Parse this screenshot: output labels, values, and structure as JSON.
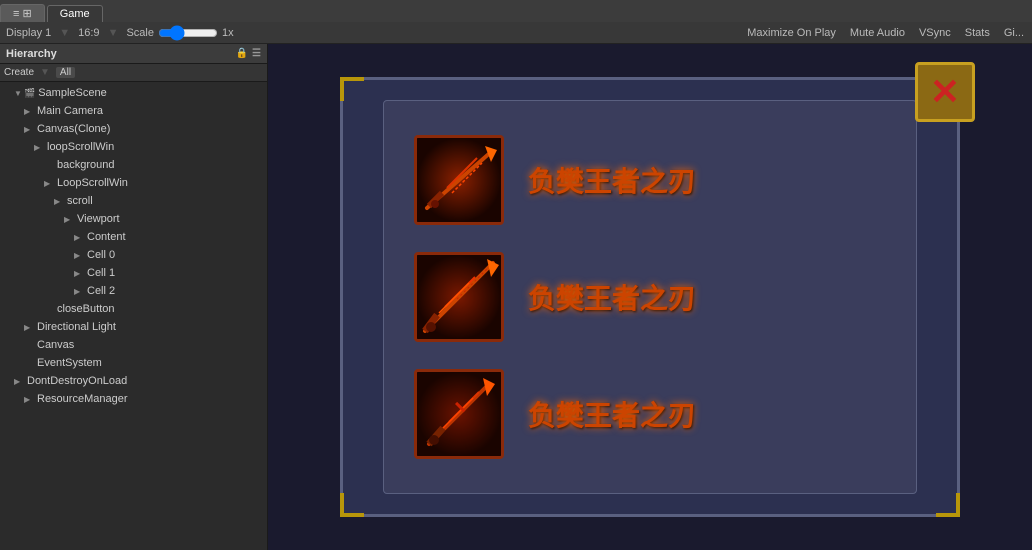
{
  "tabs": [
    {
      "label": "≡ ⊞",
      "active": false
    },
    {
      "label": "Game",
      "active": true
    }
  ],
  "toolbar": {
    "display_label": "Display 1",
    "aspect_label": "16:9",
    "scale_label": "Scale",
    "scale_value": "1x",
    "maximize_label": "Maximize On Play",
    "mute_label": "Mute Audio",
    "vsync_label": "VSync",
    "stats_label": "Stats",
    "gizmos_label": "Gi..."
  },
  "hierarchy": {
    "title": "Hierarchy",
    "create_label": "Create",
    "all_label": "All",
    "scene_name": "SampleScene",
    "items": [
      {
        "label": "Main Camera",
        "indent": "indent-2",
        "arrow": "▶",
        "icon": "📷"
      },
      {
        "label": "Canvas(Clone)",
        "indent": "indent-2",
        "arrow": "▶",
        "icon": ""
      },
      {
        "label": "loopScrollWin",
        "indent": "indent-3",
        "arrow": "▶",
        "icon": ""
      },
      {
        "label": "background",
        "indent": "indent-4",
        "arrow": "",
        "icon": ""
      },
      {
        "label": "LoopScrollWin",
        "indent": "indent-4",
        "arrow": "▶",
        "icon": ""
      },
      {
        "label": "scroll",
        "indent": "indent-5",
        "arrow": "▶",
        "icon": ""
      },
      {
        "label": "Viewport",
        "indent": "indent-6",
        "arrow": "▶",
        "icon": ""
      },
      {
        "label": "Content",
        "indent": "indent-7",
        "arrow": "▶",
        "icon": ""
      },
      {
        "label": "Cell 0",
        "indent": "indent-7",
        "arrow": "▶",
        "icon": ""
      },
      {
        "label": "Cell 1",
        "indent": "indent-7",
        "arrow": "▶",
        "icon": ""
      },
      {
        "label": "Cell 2",
        "indent": "indent-7",
        "arrow": "▶",
        "icon": ""
      },
      {
        "label": "closeButton",
        "indent": "indent-4",
        "arrow": "",
        "icon": ""
      },
      {
        "label": "Directional Light",
        "indent": "indent-2",
        "arrow": "▶",
        "icon": ""
      },
      {
        "label": "Canvas",
        "indent": "indent-2",
        "arrow": "",
        "icon": ""
      },
      {
        "label": "EventSystem",
        "indent": "indent-2",
        "arrow": "",
        "icon": ""
      },
      {
        "label": "DontDestroyOnLoad",
        "indent": "indent-1",
        "arrow": "▶",
        "icon": ""
      },
      {
        "label": "ResourceManager",
        "indent": "indent-2",
        "arrow": "▶",
        "icon": ""
      }
    ]
  },
  "game_panel": {
    "items": [
      {
        "label": "负樊王者之刃"
      },
      {
        "label": "负樊王者之刃"
      },
      {
        "label": "负樊王者之刃"
      }
    ]
  }
}
